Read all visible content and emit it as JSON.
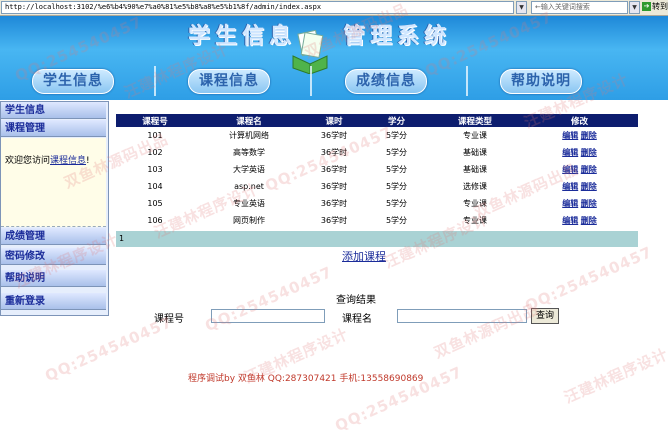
{
  "browser": {
    "address": "http://localhost:3102/%e6%b4%90%e7%a0%81%e5%b8%a8%e5%b1%8f/admin/index.aspx",
    "search_placeholder": "←输入关键词搜索",
    "go_label": "转到"
  },
  "banner": {
    "title_left": "学生信息",
    "title_right": "管理系统",
    "nav": [
      "学生信息",
      "课程信息",
      "成绩信息",
      "帮助说明"
    ]
  },
  "sidebar": {
    "items_top": [
      "学生信息",
      "课程管理"
    ],
    "welcome_prefix": "欢迎您访问",
    "welcome_link": "课程信息",
    "welcome_suffix": "!",
    "items_bottom": [
      "成绩管理",
      "密码修改",
      "帮助说明",
      "重新登录"
    ]
  },
  "table": {
    "headers": [
      "课程号",
      "课程名",
      "课时",
      "学分",
      "课程类型",
      "修改"
    ],
    "rows": [
      {
        "id": "101",
        "name": "计算机网络",
        "hours": "36学时",
        "credit": "5学分",
        "type": "专业课"
      },
      {
        "id": "102",
        "name": "高等数学",
        "hours": "36学时",
        "credit": "5学分",
        "type": "基础课"
      },
      {
        "id": "103",
        "name": "大学英语",
        "hours": "36学时",
        "credit": "5学分",
        "type": "基础课"
      },
      {
        "id": "104",
        "name": "asp.net",
        "hours": "36学时",
        "credit": "5学分",
        "type": "选修课"
      },
      {
        "id": "105",
        "name": "专业英语",
        "hours": "36学时",
        "credit": "5学分",
        "type": "专业课"
      },
      {
        "id": "106",
        "name": "网页制作",
        "hours": "36学时",
        "credit": "5学分",
        "type": "专业课"
      }
    ],
    "edit_label": "编辑",
    "delete_label": "删除",
    "pager": "1"
  },
  "actions": {
    "add_course": "添加课程"
  },
  "query": {
    "title": "查询结果",
    "course_no_label": "课程号",
    "course_name_label": "课程名",
    "button": "查询"
  },
  "footer": {
    "text": "程序调试by 双鱼林 QQ:287307421 手机:13558690869"
  },
  "watermark": {
    "qq": "QQ:254540457",
    "brand": "汪建林程序设计",
    "brand2": "双鱼林源码出品"
  }
}
